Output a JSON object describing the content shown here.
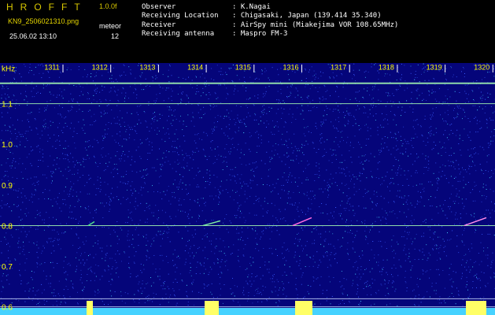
{
  "header": {
    "app_name": "HROFFT",
    "version": "1.0.0f",
    "filename": "KN9_2506021310.png",
    "meteor_label": "meteor",
    "meteor_count": "12",
    "datetime": "25.06.02 13:10",
    "info": [
      {
        "key": "Observer",
        "value": ": K.Nagai"
      },
      {
        "key": "Receiving Location",
        "value": ": Chigasaki, Japan (139.414 35.340)"
      },
      {
        "key": "Receiver",
        "value": ": AirSpy mini (Miakejima VOR 108.65MHz)"
      },
      {
        "key": "Receiving antenna",
        "value": ": Maspro FM-3"
      }
    ]
  },
  "colors": {
    "background": "#05057a",
    "noise_blue": "#3a5cff",
    "noise_cyan": "#46d2ff",
    "carrier": "#9ff2b0",
    "meteor": "#ffff66",
    "axis_label": "#ffff00"
  },
  "plot": {
    "y_unit": "kHz",
    "y_axis": {
      "min": 0.58,
      "max": 1.2,
      "ticks": [
        "1.1",
        "1.0",
        "0.9",
        "0.8",
        "0.7",
        "0.6"
      ]
    },
    "x_axis": {
      "ticks": [
        "1311",
        "1312",
        "1313",
        "1314",
        "1315",
        "1316",
        "1317",
        "1318",
        "1319",
        "1320"
      ]
    },
    "carriers_khz": [
      1.15,
      1.1,
      0.8,
      0.62,
      0.6
    ]
  }
}
